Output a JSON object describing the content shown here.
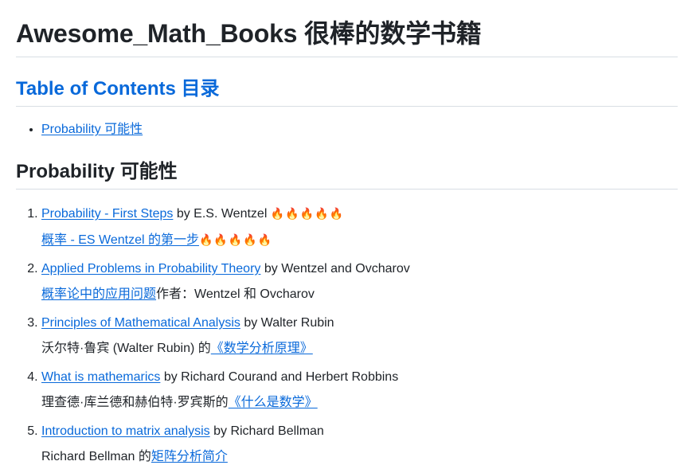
{
  "title": "Awesome_Math_Books 很棒的数学书籍",
  "toc": {
    "heading": "Table of Contents 目录",
    "items": [
      {
        "label": "Probability 可能性"
      }
    ]
  },
  "section": {
    "heading": "Probability 可能性",
    "books": [
      {
        "link": "Probability - First Steps",
        "tail": " by E.S. Wentzel ",
        "fire": "🔥🔥🔥🔥🔥",
        "line2_pre": "",
        "line2_link": "概率 - ES Wentzel 的第一步",
        "line2_post": "🔥🔥🔥🔥🔥"
      },
      {
        "link": "Applied Problems in Probability Theory",
        "tail": " by Wentzel and Ovcharov",
        "fire": "",
        "line2_pre": "",
        "line2_link": "概率论中的应用问题",
        "line2_post": "作者：Wentzel 和 Ovcharov"
      },
      {
        "link": "Principles of Mathematical Analysis",
        "tail": " by Walter Rubin",
        "fire": "",
        "line2_pre": "沃尔特·鲁宾 (Walter Rubin) 的",
        "line2_link": "《数学分析原理》",
        "line2_post": ""
      },
      {
        "link": "What is mathemarics",
        "tail": " by Richard Courand and Herbert Robbins",
        "fire": "",
        "line2_pre": "理查德·库兰德和赫伯特·罗宾斯的",
        "line2_link": "《什么是数学》",
        "line2_post": ""
      },
      {
        "link": "Introduction to matrix analysis",
        "tail": " by Richard Bellman",
        "fire": "",
        "line2_pre": "Richard Bellman 的",
        "line2_link": "矩阵分析简介",
        "line2_post": ""
      }
    ]
  },
  "colors": {
    "link": "#0969da",
    "text": "#1f2328",
    "rule": "#d8dee4"
  }
}
